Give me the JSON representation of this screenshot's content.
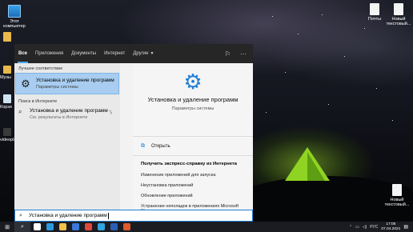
{
  "desktop": {
    "icons": [
      {
        "id": "this-pc",
        "label": "Этот компьютер"
      },
      {
        "id": "mail",
        "label": "Почты"
      },
      {
        "id": "new-text-1",
        "label": "Новый текстовый..."
      },
      {
        "id": "new-text-2",
        "label": "Новый текстовый..."
      }
    ],
    "side_peek": [
      "Музы",
      "Корзи",
      "videopla"
    ]
  },
  "search_panel": {
    "tabs": [
      {
        "label": "Все",
        "active": true
      },
      {
        "label": "Приложения"
      },
      {
        "label": "Документы"
      },
      {
        "label": "Интернет"
      },
      {
        "label": "Другие",
        "has_dropdown": true
      }
    ],
    "top_icons": [
      "feedback-icon",
      "more-icon"
    ],
    "best_match_label": "Лучшее соответствие",
    "best_match": {
      "title": "Установка и удаление программ",
      "subtitle": "Параметры системы",
      "icon": "gear-icon"
    },
    "web_label": "Поиск в Интернете",
    "web_result": {
      "title": "Установка и удаление программ -",
      "subtitle": "См. результаты в Интернете",
      "icon": "search-icon"
    },
    "detail": {
      "title": "Установка и удаление программ",
      "subtitle": "Параметры системы",
      "open_label": "Открыть",
      "help_title": "Получить экспресс-справку из Интернета",
      "help_links": [
        "Изменение приложений для запуска",
        "Неустановка приложений",
        "Обновление приложений",
        "Устранение неполадок в приложениях Microsoft Store"
      ]
    }
  },
  "search_box": {
    "value": "Установка и удаление программ"
  },
  "taskbar": {
    "apps": [
      {
        "name": "task-view-icon",
        "color": "#ffffff"
      },
      {
        "name": "edge-icon",
        "color": "#2b9ae0"
      },
      {
        "name": "explorer-icon",
        "color": "#f2c14a"
      },
      {
        "name": "store-icon",
        "color": "#3b78d8"
      },
      {
        "name": "chrome-icon",
        "color": "#e0493a"
      },
      {
        "name": "telegram-icon",
        "color": "#2ea6e0"
      },
      {
        "name": "word-icon",
        "color": "#2b5fb6"
      },
      {
        "name": "app-icon",
        "color": "#e05a2b"
      }
    ],
    "tray": {
      "lang": "РУС",
      "time": "17:05",
      "date": "07.04.2021"
    }
  },
  "colors": {
    "accent": "#1f7fd6",
    "selection": "#a8cdf0",
    "panel_header": "#262626"
  }
}
